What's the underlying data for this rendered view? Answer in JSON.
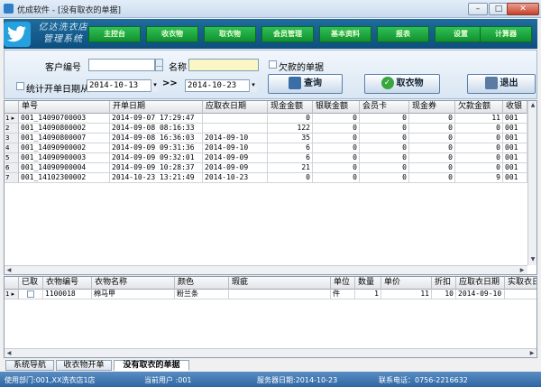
{
  "window": {
    "title": "优成软件 - [没有取衣的单据]",
    "minimize": "–",
    "maximize": "□",
    "close": "✕"
  },
  "brand": {
    "line1": "亿达洗衣店",
    "line2": "管理系统"
  },
  "nav": [
    "主控台",
    "收衣物",
    "取衣物",
    "会员管理",
    "基本资料",
    "报表",
    "设置",
    "计算器"
  ],
  "filters": {
    "customer_label": "客户编号",
    "customer_value": "",
    "name_label": "名称",
    "name_value": "",
    "unpaid_label": "欠款的单据",
    "date_label": "统计开单日期从",
    "date_from": "2014-10-13",
    "date_sep": ">>",
    "date_to": "2014-10-23",
    "query_btn": "查询",
    "pickup_btn": "取衣物",
    "exit_btn": "退出"
  },
  "orders": {
    "headers": [
      "单号",
      "开单日期",
      "应取衣日期",
      "现金金额",
      "银联金额",
      "会员卡",
      "现金券",
      "欠款金额",
      "收银"
    ],
    "rows": [
      {
        "rh": "1 ▸",
        "no": "001_14090700003",
        "open": "2014-09-07 17:29:47",
        "due": "",
        "cash": "0",
        "unionpay": "0",
        "card": "0",
        "coupon": "0",
        "owed": "11",
        "cashier": "001"
      },
      {
        "rh": "2",
        "no": "001_14090800002",
        "open": "2014-09-08 08:16:33",
        "due": "",
        "cash": "122",
        "unionpay": "0",
        "card": "0",
        "coupon": "0",
        "owed": "0",
        "cashier": "001"
      },
      {
        "rh": "3",
        "no": "001_14090800007",
        "open": "2014-09-08 16:36:03",
        "due": "2014-09-10",
        "cash": "35",
        "unionpay": "0",
        "card": "0",
        "coupon": "0",
        "owed": "0",
        "cashier": "001"
      },
      {
        "rh": "4",
        "no": "001_14090900002",
        "open": "2014-09-09 09:31:36",
        "due": "2014-09-10",
        "cash": "6",
        "unionpay": "0",
        "card": "0",
        "coupon": "0",
        "owed": "0",
        "cashier": "001"
      },
      {
        "rh": "5",
        "no": "001_14090900003",
        "open": "2014-09-09 09:32:01",
        "due": "2014-09-09",
        "cash": "6",
        "unionpay": "0",
        "card": "0",
        "coupon": "0",
        "owed": "0",
        "cashier": "001"
      },
      {
        "rh": "6",
        "no": "001_14090900004",
        "open": "2014-09-09 10:28:37",
        "due": "2014-09-09",
        "cash": "21",
        "unionpay": "0",
        "card": "0",
        "coupon": "0",
        "owed": "0",
        "cashier": "001"
      },
      {
        "rh": "7",
        "no": "001_14102300002",
        "open": "2014-10-23 13:21:49",
        "due": "2014-10-23",
        "cash": "0",
        "unionpay": "0",
        "card": "0",
        "coupon": "0",
        "owed": "9",
        "cashier": "001"
      }
    ]
  },
  "items": {
    "headers": [
      "已取",
      "衣物编号",
      "衣物名称",
      "颜色",
      "瑕疵",
      "单位",
      "数量",
      "单价",
      "折扣",
      "应取衣日期",
      "实取衣日"
    ],
    "rows": [
      {
        "rh": "1 ▸",
        "code": "1100018",
        "name": "棉马甲",
        "color": "粉兰条",
        "flaw": "",
        "unit": "件",
        "qty": "1",
        "price": "11",
        "discount": "10",
        "due": "2014-09-10",
        "actual": ""
      }
    ]
  },
  "tabs": [
    "系统导航",
    "收衣物开单",
    "没有取衣的单据"
  ],
  "status": {
    "dept": "使用部门:001,XX洗衣店1店",
    "user": "当前用户 :001",
    "server_date": "服务器日期:2014-10-23",
    "phone": "联系电话：0756-2216632"
  },
  "colors": {
    "banner": "#0d4f7e",
    "nav_green": "#11912f",
    "status_blue": "#2e67a5"
  }
}
